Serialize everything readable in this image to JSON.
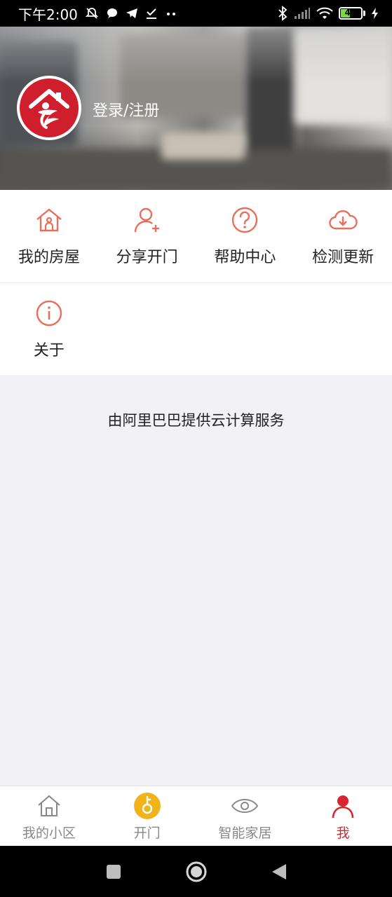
{
  "status_bar": {
    "time": "下午2:00",
    "battery": "45",
    "left_icons": [
      "mute-icon",
      "chat-icon",
      "telegram-icon",
      "download-done-icon",
      "more-dots-icon"
    ],
    "right_icons": [
      "bluetooth-icon",
      "signal-icon",
      "wifi-icon",
      "battery-icon",
      "charging-icon"
    ]
  },
  "header": {
    "login_text": "登录/注册",
    "logo_icon": "app-logo-icon"
  },
  "menu": {
    "items": [
      {
        "label": "我的房屋",
        "icon": "house-icon"
      },
      {
        "label": "分享开门",
        "icon": "add-user-icon"
      },
      {
        "label": "帮助中心",
        "icon": "help-icon"
      },
      {
        "label": "检测更新",
        "icon": "cloud-download-icon"
      },
      {
        "label": "关于",
        "icon": "info-icon"
      }
    ]
  },
  "footnote": "由阿里巴巴提供云计算服务",
  "tabbar": {
    "tabs": [
      {
        "label": "我的小区",
        "icon": "home-icon",
        "active": false
      },
      {
        "label": "开门",
        "icon": "key-icon",
        "active": false
      },
      {
        "label": "智能家居",
        "icon": "eye-icon",
        "active": false
      },
      {
        "label": "我",
        "icon": "person-icon",
        "active": true
      }
    ]
  },
  "system_nav": [
    "recents-button",
    "home-button",
    "back-button"
  ],
  "colors": {
    "accent": "#d9262e",
    "icon_orange": "#e8705a",
    "key_yellow": "#f0b41a",
    "tab_inactive": "#888888"
  }
}
